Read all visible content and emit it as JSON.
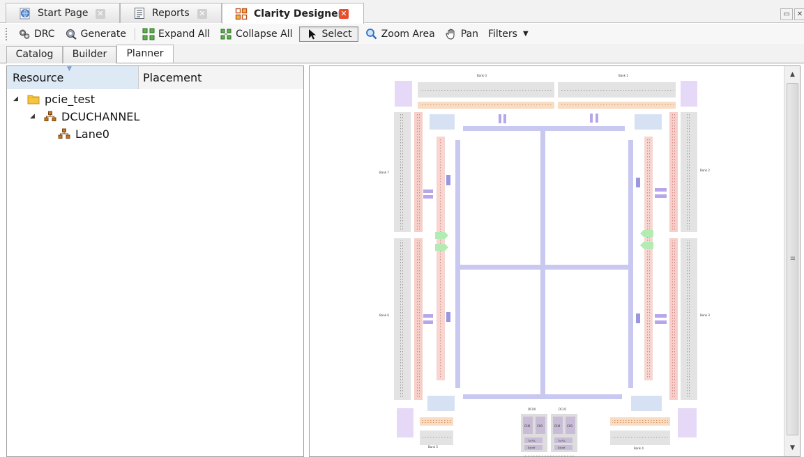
{
  "doc_tabs": [
    {
      "label": "Start Page",
      "icon": "globe-page-icon",
      "active": false
    },
    {
      "label": "Reports",
      "icon": "report-icon",
      "active": false
    },
    {
      "label": "Clarity Designer",
      "icon": "clarity-designer-icon",
      "active": true
    }
  ],
  "toolbar": {
    "drc": "DRC",
    "generate": "Generate",
    "expand_all": "Expand All",
    "collapse_all": "Collapse All",
    "select": "Select",
    "zoom_area": "Zoom Area",
    "pan": "Pan",
    "filters": "Filters"
  },
  "view_tabs": [
    "Catalog",
    "Builder",
    "Planner"
  ],
  "active_view_tab": "Planner",
  "tree": {
    "columns": [
      "Resource",
      "Placement"
    ],
    "sorted_column": "Resource",
    "rows": [
      {
        "label": "pcie_test",
        "icon": "folder-icon",
        "expanded": true
      },
      {
        "label": "DCUCHANNEL",
        "icon": "hierarchy-icon",
        "expanded": true
      },
      {
        "label": "Lane0",
        "icon": "hierarchy-icon",
        "expanded": false
      }
    ]
  },
  "floorplan": {
    "bank_labels": [
      "Bank 0",
      "Bank 1",
      "Bank 7",
      "Bank 2",
      "Bank 6",
      "Bank 3",
      "Bank 5",
      "Bank 4"
    ],
    "dcu_labels": [
      "DCU0",
      "DCU1"
    ],
    "channel_labels": [
      "CH0",
      "CH1",
      "CH0",
      "CH1"
    ],
    "aux_labels": [
      "Tx PLL",
      "Tx PLL",
      "Extref",
      "Extref"
    ]
  },
  "colors": {
    "io_bank": "#e3e3e3",
    "io_pad_row": "#f8dcc3",
    "io_vertical": "#f6cfca",
    "routing": "#c9c8f1",
    "corner_block": "#e6d9f7",
    "pll_block": "#d6e2f4",
    "dcc_block": "#b2ecb2",
    "close_hot": "#e84c2a"
  }
}
